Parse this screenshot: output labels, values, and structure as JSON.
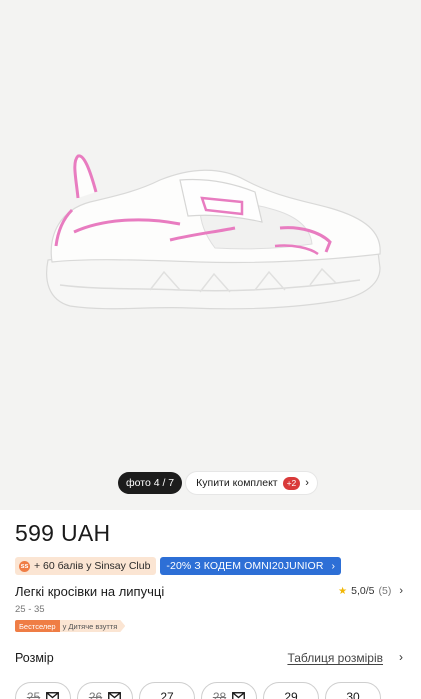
{
  "gallery": {
    "photo_counter": "фото 4 / 7",
    "kit_label": "Купити комплект",
    "kit_badge": "+2"
  },
  "product": {
    "price": "599 UAH",
    "club_text": "+ 60 балів у Sinsay Club",
    "club_icon": "ss",
    "coupon_text": "-20% З КОДЕМ OMNI20JUNIOR",
    "title": "Легкі кросівки на липучці",
    "rating_value": "5,0/5",
    "rating_count": "(5)",
    "size_range": "25 - 35",
    "tag_bestseller": "Бестселер",
    "tag_category": "у Дитяче взуття"
  },
  "size_section": {
    "label": "Розмір",
    "table_link": "Таблиця розмірів",
    "sizes": [
      {
        "label": "25",
        "available": false
      },
      {
        "label": "26",
        "available": false
      },
      {
        "label": "27",
        "available": true
      },
      {
        "label": "28",
        "available": false
      },
      {
        "label": "29",
        "available": true
      },
      {
        "label": "30",
        "available": true
      }
    ]
  },
  "colors": {
    "accent_pink": "#e87cc0",
    "coupon_blue": "#2d6fd6",
    "club_orange": "#ef7d45"
  }
}
